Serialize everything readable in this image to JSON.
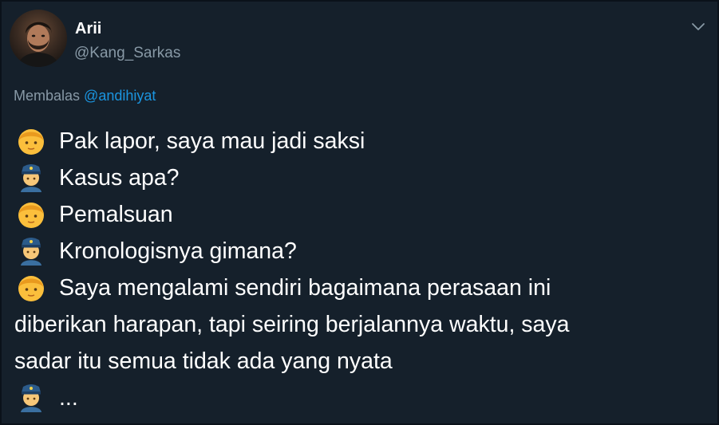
{
  "user": {
    "name": "Arii",
    "handle": "@Kang_Sarkas"
  },
  "reply": {
    "prefix": "Membalas",
    "mention": "@andihiyat"
  },
  "colors": {
    "background": "#15202b",
    "secondary_text": "#8899a6",
    "link": "#1b95e0",
    "text": "#ffffff"
  },
  "icons": {
    "caret": "chevron-down-icon",
    "person": "person-emoji-icon",
    "police": "police-officer-emoji-icon"
  },
  "lines": [
    {
      "speaker": "person",
      "text": "Pak lapor, saya mau jadi saksi"
    },
    {
      "speaker": "police",
      "text": "Kasus apa?"
    },
    {
      "speaker": "person",
      "text": "Pemalsuan"
    },
    {
      "speaker": "police",
      "text": "Kronologisnya gimana?"
    },
    {
      "speaker": "person",
      "text": "Saya mengalami sendiri bagaimana perasaan ini"
    },
    {
      "speaker": "",
      "text": "diberikan harapan, tapi seiring berjalannya waktu, saya"
    },
    {
      "speaker": "",
      "text": "sadar itu semua tidak ada yang nyata"
    },
    {
      "speaker": "police",
      "text": "..."
    }
  ]
}
